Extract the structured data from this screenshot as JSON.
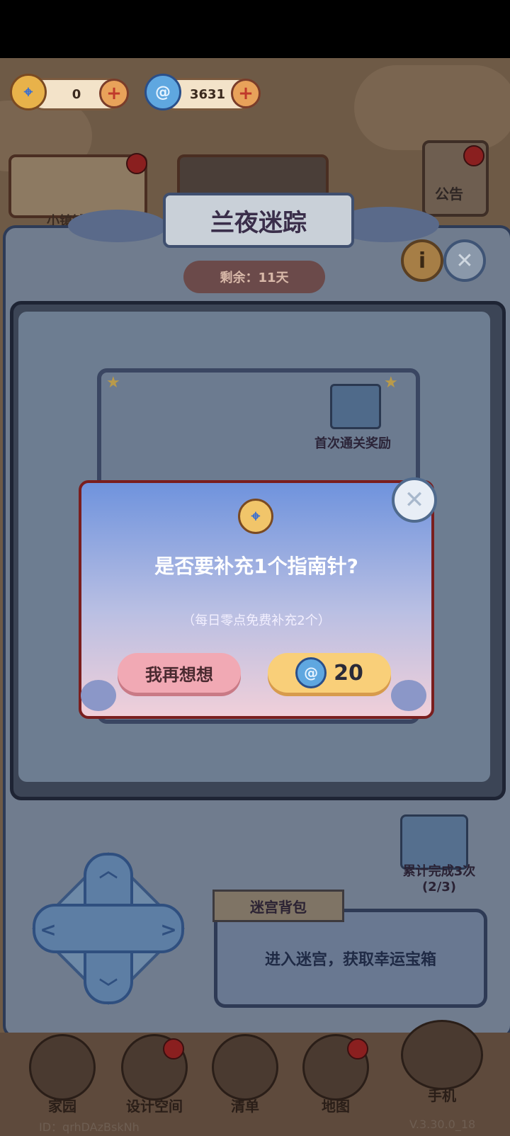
{
  "currencies": [
    {
      "icon": "compass-icon",
      "value": "0"
    },
    {
      "icon": "swirl-gem-icon",
      "value": "3631"
    }
  ],
  "topright": {
    "notice_label": "公告"
  },
  "bg_card_label": "小镇铺",
  "event": {
    "title": "兰夜迷踪",
    "remaining": "剩余：11天",
    "first_clear_reward": "首次通关奖励",
    "cumulative_reward": "累计完成3次",
    "cumulative_progress": "(2/3)"
  },
  "backpack": {
    "tab_label": "迷宫背包",
    "empty_text": "进入迷宫，获取幸运宝箱"
  },
  "dialog": {
    "title": "是否要补充1个指南针?",
    "subtitle": "（每日零点免费补充2个）",
    "cancel_label": "我再想想",
    "confirm_cost": "20"
  },
  "nav": [
    {
      "label": "家园"
    },
    {
      "label": "设计空间"
    },
    {
      "label": "清单"
    },
    {
      "label": "地图"
    },
    {
      "label": "手机"
    }
  ],
  "footer": {
    "id": "ID：qrhDAzBskNh",
    "version": "V.3.30.0_18"
  },
  "colors": {
    "dialog_top": "#6f93dd",
    "dialog_bottom": "#f0cfd9",
    "confirm": "#f9cf79",
    "cancel": "#f1a9b4"
  }
}
